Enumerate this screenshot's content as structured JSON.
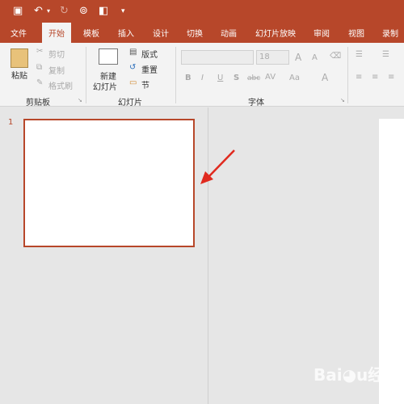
{
  "quick_access": {
    "save": "save-icon",
    "undo": "undo-icon",
    "redo": "redo-icon",
    "present": "present-icon",
    "layout": "layout-icon",
    "more": "▾"
  },
  "tabs": [
    "文件",
    "开始",
    "模板",
    "插入",
    "设计",
    "切换",
    "动画",
    "幻灯片放映",
    "审阅",
    "视图",
    "录制"
  ],
  "active_tab": "开始",
  "clipboard": {
    "paste": "粘贴",
    "cut": "剪切",
    "copy": "复制",
    "format_painter": "格式刷",
    "group": "剪贴板"
  },
  "slides": {
    "new_slide_1": "新建",
    "new_slide_2": "幻灯片",
    "layout": "版式",
    "reset": "重置",
    "section": "节",
    "group": "幻灯片"
  },
  "font": {
    "font_name": "",
    "font_size": "18",
    "bold": "B",
    "italic": "I",
    "underline": "U",
    "shadow": "S",
    "strike": "abc",
    "spacing": "AV",
    "case": "Aa",
    "color": "A",
    "grow": "A",
    "shrink": "A",
    "group": "字体"
  },
  "thumbnail": {
    "number": "1"
  },
  "watermark": "Baidu经验 jingyan.baidu.com",
  "colors": {
    "accent": "#b7472a",
    "annotation_arrow": "#e02a1f"
  }
}
